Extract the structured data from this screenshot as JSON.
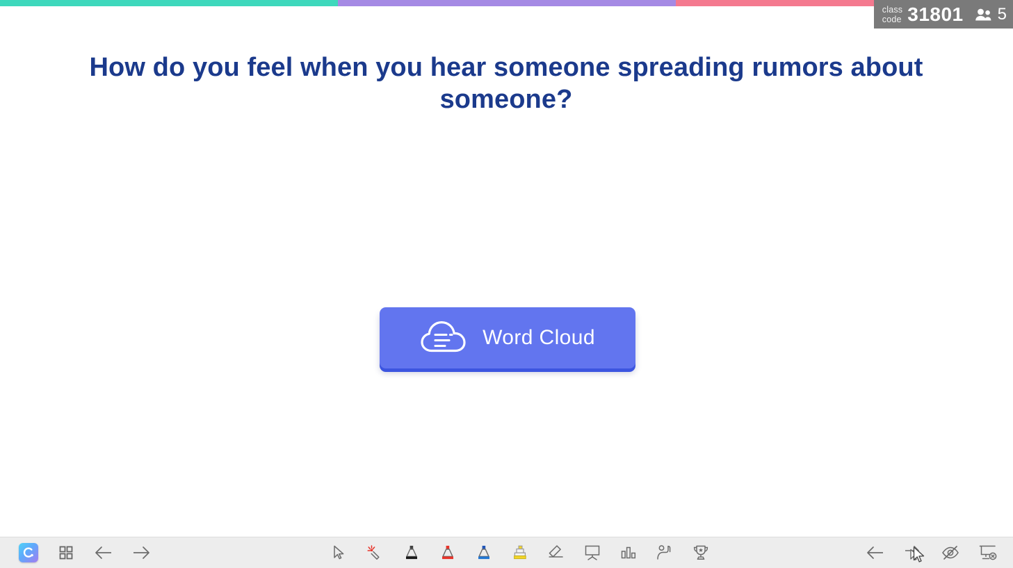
{
  "top_bar": {
    "segments": [
      {
        "name": "teal-segment",
        "color": "#3ed8bc"
      },
      {
        "name": "purple-segment",
        "color": "#a58ae4"
      },
      {
        "name": "pink-segment",
        "color": "#f4798f"
      }
    ]
  },
  "class_badge": {
    "label_line1": "class",
    "label_line2": "code",
    "code": "31801",
    "participants_icon": "people-icon",
    "participant_count": "5",
    "background_color": "#7a7a7a"
  },
  "slide": {
    "title": "How do you feel when you hear someone spreading rumors about someone?",
    "title_color": "#1b3a8c"
  },
  "activity_button": {
    "label": "Word Cloud",
    "icon": "word-cloud-icon",
    "background_color": "#6275ef",
    "shadow_color": "#3c55e0",
    "text_color": "#ffffff"
  },
  "toolbar": {
    "background_color": "#ededed",
    "left_items": [
      {
        "name": "classpoint-logo",
        "icon": "classpoint-logo-icon",
        "label": "ClassPoint"
      },
      {
        "name": "slide-grid-button",
        "icon": "grid-icon",
        "label": "Slide Overview"
      },
      {
        "name": "previous-slide-button",
        "icon": "arrow-left-icon",
        "label": "Previous"
      },
      {
        "name": "next-slide-button",
        "icon": "arrow-right-icon",
        "label": "Next"
      }
    ],
    "center_items": [
      {
        "name": "select-tool",
        "icon": "cursor-icon",
        "label": "Select",
        "active": false
      },
      {
        "name": "laser-pointer-tool",
        "icon": "laser-pointer-icon",
        "label": "Laser Pointer",
        "active": false
      },
      {
        "name": "pen-black-tool",
        "icon": "pen-icon",
        "label": "Black Pen",
        "color": "#1a1a1a",
        "active": false
      },
      {
        "name": "pen-red-tool",
        "icon": "pen-icon",
        "label": "Red Pen",
        "color": "#e8342a",
        "active": false
      },
      {
        "name": "pen-blue-tool",
        "icon": "pen-icon",
        "label": "Blue Pen",
        "color": "#2277d4",
        "active": false
      },
      {
        "name": "highlighter-tool",
        "icon": "highlighter-icon",
        "label": "Highlighter",
        "color": "#f2d429",
        "active": true
      },
      {
        "name": "eraser-tool",
        "icon": "eraser-icon",
        "label": "Eraser",
        "active": false
      },
      {
        "name": "whiteboard-tool",
        "icon": "whiteboard-icon",
        "label": "Whiteboard",
        "active": false
      },
      {
        "name": "quick-poll-tool",
        "icon": "bar-chart-icon",
        "label": "Quick Poll",
        "active": false
      },
      {
        "name": "pick-names-tool",
        "icon": "raise-hand-icon",
        "label": "Pick Names",
        "active": false
      },
      {
        "name": "leaderboard-tool",
        "icon": "trophy-icon",
        "label": "Leaderboard",
        "active": false
      }
    ],
    "right_items": [
      {
        "name": "back-button",
        "icon": "arrow-left-icon",
        "label": "Back"
      },
      {
        "name": "forward-pointer-button",
        "icon": "arrow-right-cursor-icon",
        "label": "Forward"
      },
      {
        "name": "hide-button",
        "icon": "eye-slash-icon",
        "label": "Hide Presentation"
      },
      {
        "name": "end-presentation-button",
        "icon": "end-presentation-icon",
        "label": "End Show"
      }
    ]
  }
}
